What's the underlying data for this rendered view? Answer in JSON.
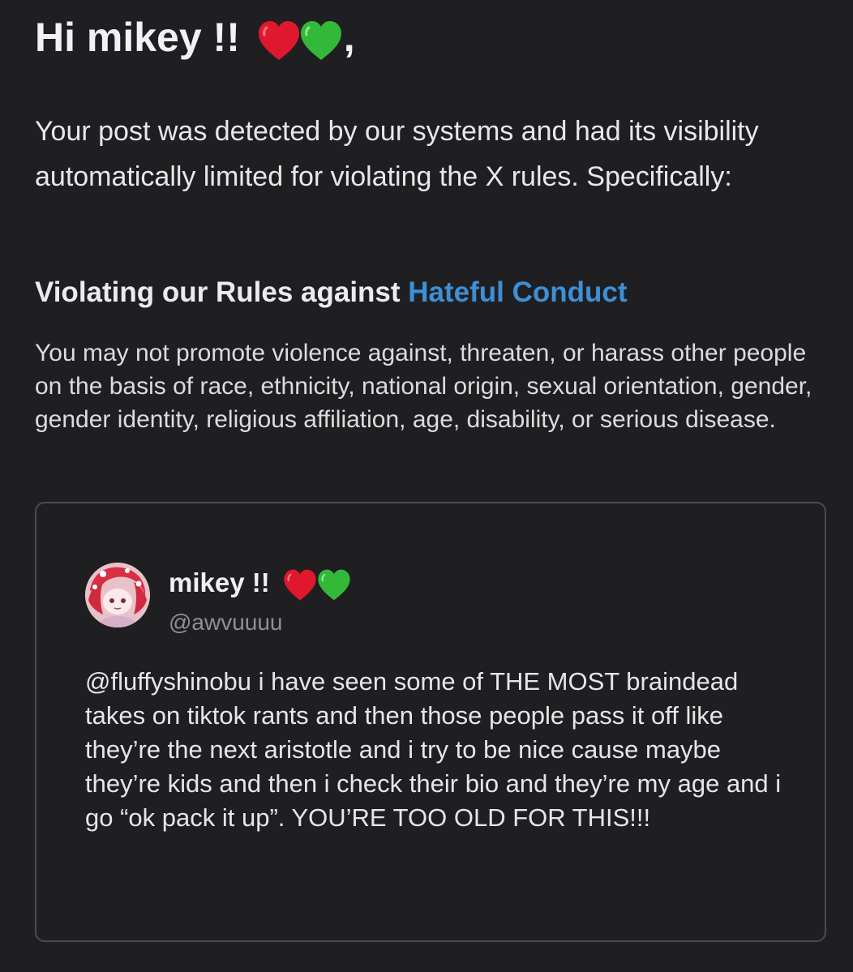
{
  "greeting": {
    "text": "Hi mikey !!",
    "suffix": ","
  },
  "intro": {
    "text": "Your post was detected by our systems and had its visibility automatically limited for violating the X rules. Specifically:"
  },
  "rule": {
    "prefix": "Violating our Rules against ",
    "link_label": "Hateful Conduct",
    "link_color": "#3d8fd6",
    "description": "You may not promote violence against, threaten, or harass other people on the basis of race, ethnicity, national origin, sexual orientation, gender, gender identity, religious affiliation, age, disability, or serious disease."
  },
  "post": {
    "author_name": "mikey !!",
    "author_handle": "@awvuuuu",
    "text": "@fluffyshinobu i have seen some of THE MOST braindead takes on tiktok rants and then those people pass it off like they’re the next aristotle and i try to be nice cause maybe they’re kids and then i check their bio and they’re my age and i go “ok pack it up”. YOU’RE TOO OLD FOR THIS!!!"
  },
  "icons": {
    "red_heart": "red-heart-emoji",
    "green_heart": "green-heart-emoji"
  },
  "colors": {
    "background": "#1f1f21",
    "text": "#e8e8ea",
    "handle": "#8e9096",
    "card_border": "#4a4c52",
    "red_heart": "#e0182d",
    "green_heart": "#33b83a"
  }
}
